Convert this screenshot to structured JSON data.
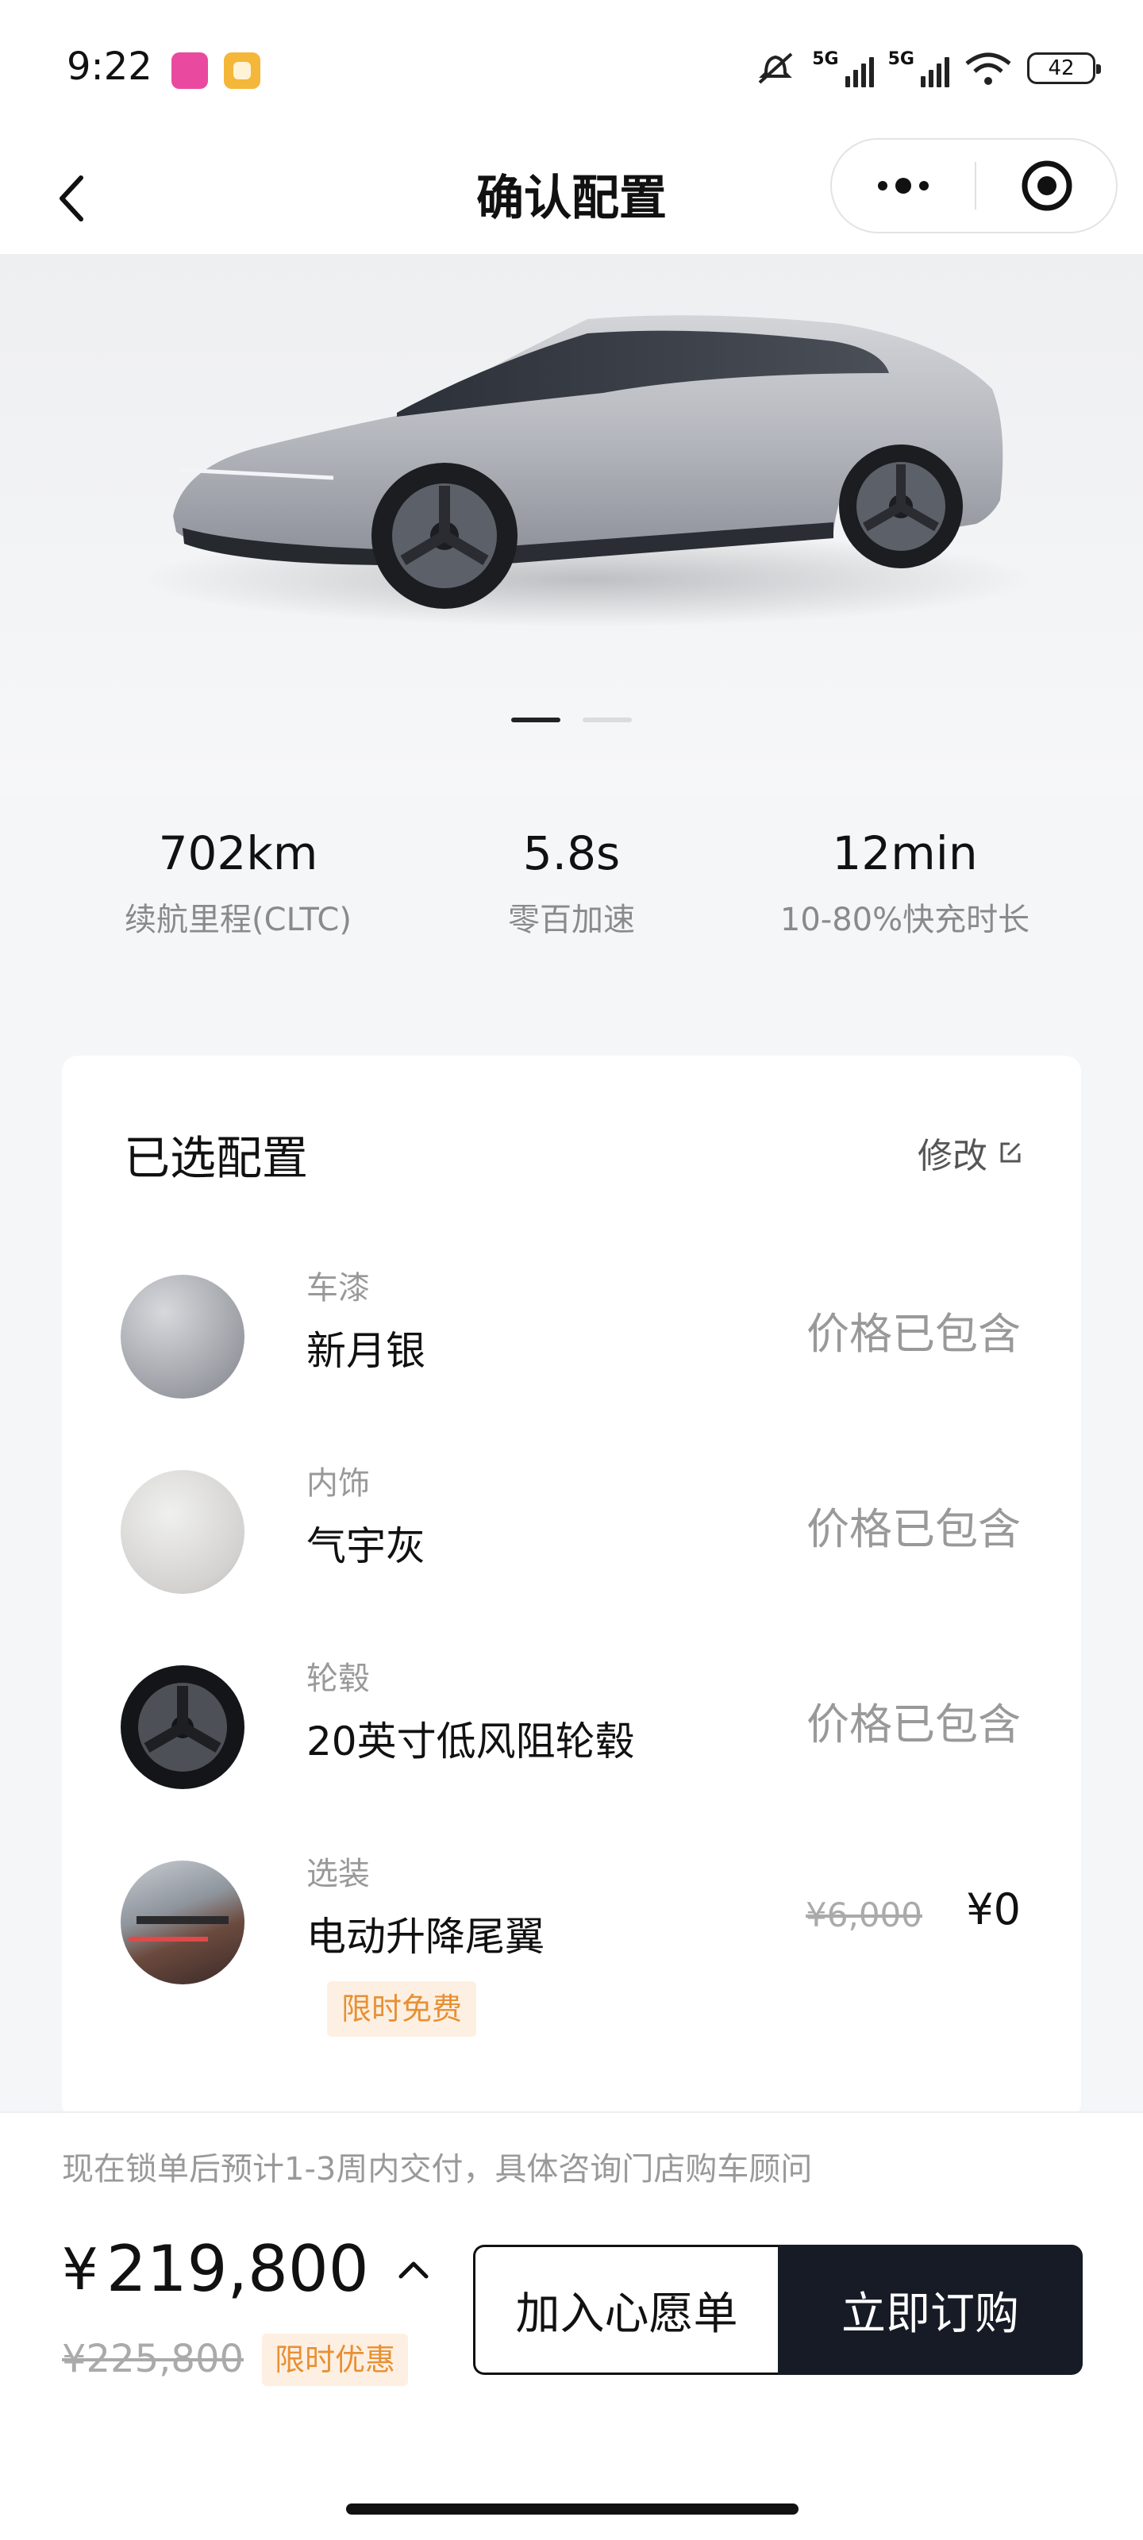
{
  "status_bar": {
    "time": "9:22",
    "network_1": "5G",
    "network_2": "5G",
    "battery": "42",
    "icons": [
      "mute-icon",
      "signal-icon",
      "wifi-icon",
      "battery-icon"
    ]
  },
  "nav": {
    "title": "确认配置",
    "back_icon": "chevron-left-icon",
    "more_icon": "more-dots-icon",
    "close_icon": "target-close-icon"
  },
  "hero": {
    "carousel_total": 2,
    "carousel_active": 1
  },
  "specs": [
    {
      "value": "702km",
      "label": "续航里程(CLTC)"
    },
    {
      "value": "5.8s",
      "label": "零百加速"
    },
    {
      "value": "12min",
      "label": "10-80%快充时长"
    }
  ],
  "config": {
    "title": "已选配置",
    "edit_label": "修改",
    "options": [
      {
        "category": "车漆",
        "name": "新月银",
        "price": "价格已包含"
      },
      {
        "category": "内饰",
        "name": "气宇灰",
        "price": "价格已包含"
      },
      {
        "category": "轮毂",
        "name": "20英寸低风阻轮毂",
        "price": "价格已包含"
      },
      {
        "category": "选装",
        "name": "电动升降尾翼",
        "price_old": "¥6,000",
        "price_new": "¥0",
        "tag": "限时免费"
      }
    ]
  },
  "bottom": {
    "notice": "现在锁单后预计1-3周内交付，具体咨询门店购车顾问",
    "currency": "¥",
    "price": "219,800",
    "original_price": "¥225,800",
    "promo_tag": "限时优惠",
    "wishlist_label": "加入心愿单",
    "buy_label": "立即订购"
  },
  "colors": {
    "accent_dark": "#161b25",
    "promo_bg": "#fdf0e2",
    "promo_text": "#e89035"
  }
}
